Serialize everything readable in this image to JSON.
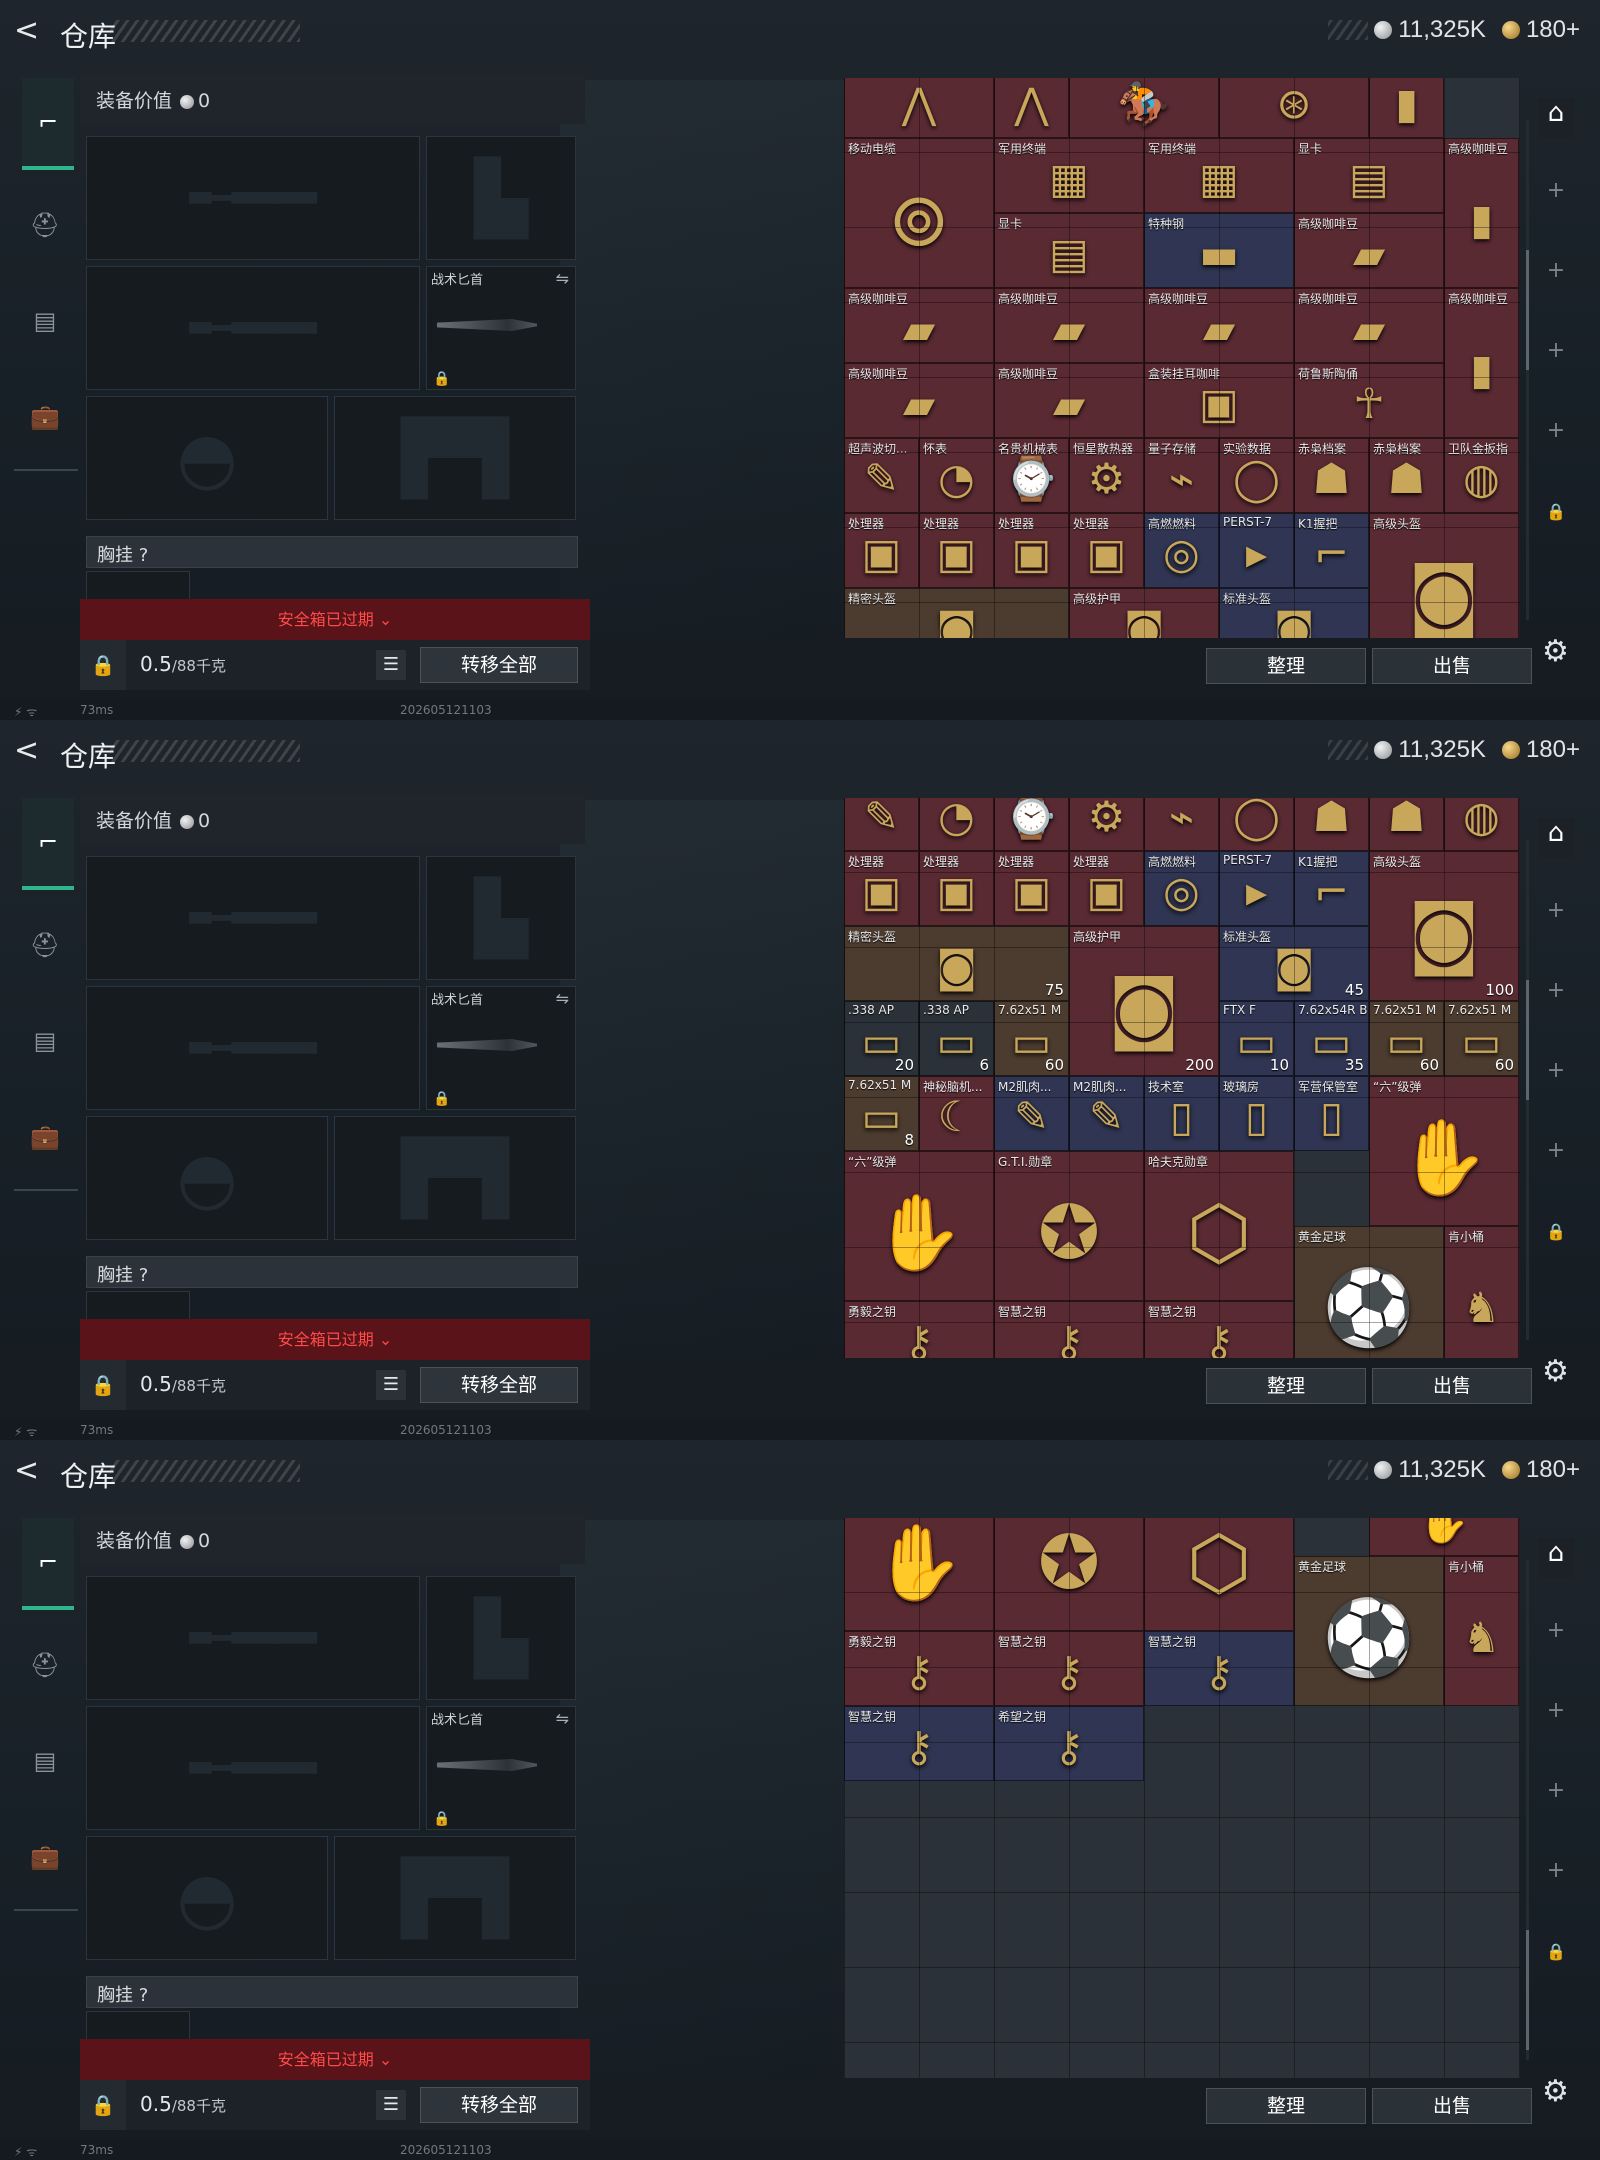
{
  "header": {
    "back_glyph": "<",
    "title": "仓库",
    "coins": "11,325K",
    "tickets": "180+"
  },
  "equip": {
    "value_label": "装备价值",
    "value": "0",
    "knife_label": "战术匕首",
    "chest_label": "胸挂",
    "chest_help": "?",
    "expired": "安全箱已过期",
    "weight": "0.5",
    "weight_unit": "/88千克",
    "transfer_all": "转移全部"
  },
  "actions": {
    "sort": "整理",
    "sell": "出售"
  },
  "status": {
    "ping": "73ms",
    "build": "202605121103"
  },
  "icons": [
    "back-icon",
    "silver-coin-icon",
    "gold-coin-icon",
    "gun-icon",
    "backpack-icon",
    "vest-icon",
    "briefcase-icon",
    "lock-icon",
    "list-icon",
    "gear-icon",
    "safehouse-icon",
    "plus-icon",
    "swap-icon"
  ],
  "screens": [
    {
      "items": [
        {
          "name": "",
          "color": "red",
          "c": 0,
          "r": -0.2,
          "w": 2,
          "h": 1,
          "glyph": "⋀"
        },
        {
          "name": "",
          "color": "red",
          "c": 2,
          "r": -0.2,
          "w": 1,
          "h": 1,
          "glyph": "⋀"
        },
        {
          "name": "",
          "color": "red",
          "c": 3,
          "r": -0.2,
          "w": 2,
          "h": 1,
          "glyph": "🏇"
        },
        {
          "name": "",
          "color": "red",
          "c": 5,
          "r": -0.2,
          "w": 2,
          "h": 1,
          "glyph": "⊛"
        },
        {
          "name": "",
          "color": "red",
          "c": 7,
          "r": -0.2,
          "w": 1,
          "h": 1,
          "glyph": "▮"
        },
        {
          "name": "移动电缆",
          "color": "red",
          "c": 0,
          "r": 0.8,
          "w": 2,
          "h": 2,
          "glyph": "⊚"
        },
        {
          "name": "军用终端",
          "color": "red",
          "c": 2,
          "r": 0.8,
          "w": 2,
          "h": 1,
          "glyph": "▦"
        },
        {
          "name": "军用终端",
          "color": "red",
          "c": 4,
          "r": 0.8,
          "w": 2,
          "h": 1,
          "glyph": "▦"
        },
        {
          "name": "显卡",
          "color": "red",
          "c": 6,
          "r": 0.8,
          "w": 2,
          "h": 1,
          "glyph": "▤"
        },
        {
          "name": "高级咖啡豆",
          "color": "red",
          "c": 8,
          "r": 0.8,
          "w": 1,
          "h": 2,
          "glyph": "▮"
        },
        {
          "name": "显卡",
          "color": "red",
          "c": 2,
          "r": 1.8,
          "w": 2,
          "h": 1,
          "glyph": "▤"
        },
        {
          "name": "特种钢",
          "color": "blue",
          "c": 4,
          "r": 1.8,
          "w": 2,
          "h": 1,
          "glyph": "▬"
        },
        {
          "name": "高级咖啡豆",
          "color": "red",
          "c": 6,
          "r": 1.8,
          "w": 2,
          "h": 1,
          "glyph": "▰"
        },
        {
          "name": "高级咖啡豆",
          "color": "red",
          "c": 0,
          "r": 2.8,
          "w": 2,
          "h": 1,
          "glyph": "▰"
        },
        {
          "name": "高级咖啡豆",
          "color": "red",
          "c": 2,
          "r": 2.8,
          "w": 2,
          "h": 1,
          "glyph": "▰"
        },
        {
          "name": "高级咖啡豆",
          "color": "red",
          "c": 4,
          "r": 2.8,
          "w": 2,
          "h": 1,
          "glyph": "▰"
        },
        {
          "name": "高级咖啡豆",
          "color": "red",
          "c": 6,
          "r": 2.8,
          "w": 2,
          "h": 1,
          "glyph": "▰"
        },
        {
          "name": "高级咖啡豆",
          "color": "red",
          "c": 8,
          "r": 2.8,
          "w": 1,
          "h": 2,
          "glyph": "▮"
        },
        {
          "name": "高级咖啡豆",
          "color": "red",
          "c": 0,
          "r": 3.8,
          "w": 2,
          "h": 1,
          "glyph": "▰"
        },
        {
          "name": "高级咖啡豆",
          "color": "red",
          "c": 2,
          "r": 3.8,
          "w": 2,
          "h": 1,
          "glyph": "▰"
        },
        {
          "name": "盒装挂耳咖啡",
          "color": "red",
          "c": 4,
          "r": 3.8,
          "w": 2,
          "h": 1,
          "glyph": "▣"
        },
        {
          "name": "荷鲁斯陶俑",
          "color": "red",
          "c": 6,
          "r": 3.8,
          "w": 2,
          "h": 1,
          "glyph": "☥"
        },
        {
          "name": "超声波切...",
          "color": "red",
          "c": 0,
          "r": 4.8,
          "w": 1,
          "h": 1,
          "glyph": "✎"
        },
        {
          "name": "怀表",
          "color": "red",
          "c": 1,
          "r": 4.8,
          "w": 1,
          "h": 1,
          "glyph": "◔"
        },
        {
          "name": "名贵机械表",
          "color": "red",
          "c": 2,
          "r": 4.8,
          "w": 1,
          "h": 1,
          "glyph": "⌚"
        },
        {
          "name": "恒星散热器",
          "color": "red",
          "c": 3,
          "r": 4.8,
          "w": 1,
          "h": 1,
          "glyph": "⚙"
        },
        {
          "name": "量子存储",
          "color": "red",
          "c": 4,
          "r": 4.8,
          "w": 1,
          "h": 1,
          "glyph": "⌁"
        },
        {
          "name": "实验数据",
          "color": "red",
          "c": 5,
          "r": 4.8,
          "w": 1,
          "h": 1,
          "glyph": "◯"
        },
        {
          "name": "赤枭档案",
          "color": "red",
          "c": 6,
          "r": 4.8,
          "w": 1,
          "h": 1,
          "glyph": "☗"
        },
        {
          "name": "赤枭档案",
          "color": "red",
          "c": 7,
          "r": 4.8,
          "w": 1,
          "h": 1,
          "glyph": "☗"
        },
        {
          "name": "卫队金扳指",
          "color": "red",
          "c": 8,
          "r": 4.8,
          "w": 1,
          "h": 1,
          "glyph": "◍"
        },
        {
          "name": "处理器",
          "color": "red",
          "c": 0,
          "r": 5.8,
          "w": 1,
          "h": 1,
          "glyph": "▣"
        },
        {
          "name": "处理器",
          "color": "red",
          "c": 1,
          "r": 5.8,
          "w": 1,
          "h": 1,
          "glyph": "▣"
        },
        {
          "name": "处理器",
          "color": "red",
          "c": 2,
          "r": 5.8,
          "w": 1,
          "h": 1,
          "glyph": "▣"
        },
        {
          "name": "处理器",
          "color": "red",
          "c": 3,
          "r": 5.8,
          "w": 1,
          "h": 1,
          "glyph": "▣"
        },
        {
          "name": "高燃燃料",
          "color": "blue",
          "c": 4,
          "r": 5.8,
          "w": 1,
          "h": 1,
          "glyph": "◎"
        },
        {
          "name": "PERST-7",
          "color": "blue",
          "c": 5,
          "r": 5.8,
          "w": 1,
          "h": 1,
          "glyph": "▸"
        },
        {
          "name": "K1握把",
          "color": "blue",
          "c": 6,
          "r": 5.8,
          "w": 1,
          "h": 1,
          "glyph": "⌐"
        },
        {
          "name": "高级头盔",
          "color": "red",
          "c": 7,
          "r": 5.8,
          "w": 2,
          "h": 2,
          "glyph": "◙"
        },
        {
          "name": "精密头盔",
          "color": "brown",
          "c": 0,
          "r": 6.8,
          "w": 3,
          "h": 1,
          "glyph": "◙"
        },
        {
          "name": "高级护甲",
          "color": "red",
          "c": 3,
          "r": 6.8,
          "w": 2,
          "h": 1,
          "glyph": "◙"
        },
        {
          "name": "标准头盔",
          "color": "blue",
          "c": 5,
          "r": 6.8,
          "w": 2,
          "h": 1,
          "glyph": "◙"
        }
      ]
    },
    {
      "items": [
        {
          "name": "超声波切...",
          "color": "red",
          "c": 0,
          "r": -0.3,
          "w": 1,
          "h": 1,
          "glyph": "✎"
        },
        {
          "name": "怀表",
          "color": "red",
          "c": 1,
          "r": -0.3,
          "w": 1,
          "h": 1,
          "glyph": "◔"
        },
        {
          "name": "名贵机械表",
          "color": "red",
          "c": 2,
          "r": -0.3,
          "w": 1,
          "h": 1,
          "glyph": "⌚"
        },
        {
          "name": "恒星散热器",
          "color": "red",
          "c": 3,
          "r": -0.3,
          "w": 1,
          "h": 1,
          "glyph": "⚙"
        },
        {
          "name": "量子存储",
          "color": "red",
          "c": 4,
          "r": -0.3,
          "w": 1,
          "h": 1,
          "glyph": "⌁"
        },
        {
          "name": "实验数据",
          "color": "red",
          "c": 5,
          "r": -0.3,
          "w": 1,
          "h": 1,
          "glyph": "◯"
        },
        {
          "name": "赤枭档案",
          "color": "red",
          "c": 6,
          "r": -0.3,
          "w": 1,
          "h": 1,
          "glyph": "☗"
        },
        {
          "name": "赤枭档案",
          "color": "red",
          "c": 7,
          "r": -0.3,
          "w": 1,
          "h": 1,
          "glyph": "☗"
        },
        {
          "name": "卫队金扳指",
          "color": "red",
          "c": 8,
          "r": -0.3,
          "w": 1,
          "h": 1,
          "glyph": "◍"
        },
        {
          "name": "处理器",
          "color": "red",
          "c": 0,
          "r": 0.7,
          "w": 1,
          "h": 1,
          "glyph": "▣"
        },
        {
          "name": "处理器",
          "color": "red",
          "c": 1,
          "r": 0.7,
          "w": 1,
          "h": 1,
          "glyph": "▣"
        },
        {
          "name": "处理器",
          "color": "red",
          "c": 2,
          "r": 0.7,
          "w": 1,
          "h": 1,
          "glyph": "▣"
        },
        {
          "name": "处理器",
          "color": "red",
          "c": 3,
          "r": 0.7,
          "w": 1,
          "h": 1,
          "glyph": "▣"
        },
        {
          "name": "高燃燃料",
          "color": "blue",
          "c": 4,
          "r": 0.7,
          "w": 1,
          "h": 1,
          "glyph": "◎"
        },
        {
          "name": "PERST-7",
          "color": "blue",
          "c": 5,
          "r": 0.7,
          "w": 1,
          "h": 1,
          "glyph": "▸"
        },
        {
          "name": "K1握把",
          "color": "blue",
          "c": 6,
          "r": 0.7,
          "w": 1,
          "h": 1,
          "glyph": "⌐"
        },
        {
          "name": "高级头盔",
          "color": "red",
          "c": 7,
          "r": 0.7,
          "w": 2,
          "h": 2,
          "glyph": "◙",
          "qty": "100"
        },
        {
          "name": "精密头盔",
          "color": "brown",
          "c": 0,
          "r": 1.7,
          "w": 3,
          "h": 1,
          "glyph": "◙",
          "qty": "75"
        },
        {
          "name": "高级护甲",
          "color": "red",
          "c": 3,
          "r": 1.7,
          "w": 2,
          "h": 2,
          "glyph": "◙",
          "qty": "200"
        },
        {
          "name": "标准头盔",
          "color": "blue",
          "c": 5,
          "r": 1.7,
          "w": 2,
          "h": 1,
          "glyph": "◙",
          "qty": "45"
        },
        {
          "name": ".338 AP",
          "color": "dark",
          "c": 0,
          "r": 2.7,
          "w": 1,
          "h": 1,
          "glyph": "▭",
          "qty": "20"
        },
        {
          "name": ".338 AP",
          "color": "dark",
          "c": 1,
          "r": 2.7,
          "w": 1,
          "h": 1,
          "glyph": "▭",
          "qty": "6"
        },
        {
          "name": "7.62x51 M",
          "color": "brown",
          "c": 2,
          "r": 2.7,
          "w": 1,
          "h": 1,
          "glyph": "▭",
          "qty": "60"
        },
        {
          "name": "FTX F",
          "color": "blue",
          "c": 5,
          "r": 2.7,
          "w": 1,
          "h": 1,
          "glyph": "▭",
          "qty": "10"
        },
        {
          "name": "7.62x54R B",
          "color": "blue",
          "c": 6,
          "r": 2.7,
          "w": 1,
          "h": 1,
          "glyph": "▭",
          "qty": "35"
        },
        {
          "name": "7.62x51 M",
          "color": "brown",
          "c": 7,
          "r": 2.7,
          "w": 1,
          "h": 1,
          "glyph": "▭",
          "qty": "60"
        },
        {
          "name": "7.62x51 M",
          "color": "brown",
          "c": 8,
          "r": 2.7,
          "w": 1,
          "h": 1,
          "glyph": "▭",
          "qty": "60"
        },
        {
          "name": "7.62x51 M",
          "color": "brown",
          "c": 0,
          "r": 3.7,
          "w": 1,
          "h": 1,
          "glyph": "▭",
          "qty": "8"
        },
        {
          "name": "神秘脑机...",
          "color": "red",
          "c": 1,
          "r": 3.7,
          "w": 1,
          "h": 1,
          "glyph": "☾"
        },
        {
          "name": "M2肌肉...",
          "color": "blue",
          "c": 2,
          "r": 3.7,
          "w": 1,
          "h": 1,
          "glyph": "✎"
        },
        {
          "name": "M2肌肉...",
          "color": "blue",
          "c": 3,
          "r": 3.7,
          "w": 1,
          "h": 1,
          "glyph": "✎"
        },
        {
          "name": "技术室",
          "color": "blue",
          "c": 4,
          "r": 3.7,
          "w": 1,
          "h": 1,
          "glyph": "▯"
        },
        {
          "name": "玻璃房",
          "color": "blue",
          "c": 5,
          "r": 3.7,
          "w": 1,
          "h": 1,
          "glyph": "▯"
        },
        {
          "name": "军营保管室",
          "color": "blue",
          "c": 6,
          "r": 3.7,
          "w": 1,
          "h": 1,
          "glyph": "▯"
        },
        {
          "name": "“六”级弹",
          "color": "red",
          "c": 7,
          "r": 3.7,
          "w": 2,
          "h": 2,
          "glyph": "✋"
        },
        {
          "name": "“六”级弹",
          "color": "red",
          "c": 0,
          "r": 4.7,
          "w": 2,
          "h": 2,
          "glyph": "✋"
        },
        {
          "name": "G.T.I.勋章",
          "color": "red",
          "c": 2,
          "r": 4.7,
          "w": 2,
          "h": 2,
          "glyph": "✪"
        },
        {
          "name": "哈夫克勋章",
          "color": "red",
          "c": 4,
          "r": 4.7,
          "w": 2,
          "h": 2,
          "glyph": "⬡"
        },
        {
          "name": "黄金足球",
          "color": "brown",
          "c": 6,
          "r": 5.7,
          "w": 2,
          "h": 2,
          "glyph": "⚽"
        },
        {
          "name": "肯小桶",
          "color": "red",
          "c": 8,
          "r": 5.7,
          "w": 1,
          "h": 2,
          "glyph": "♞"
        },
        {
          "name": "勇毅之钥",
          "color": "red",
          "c": 0,
          "r": 6.7,
          "w": 2,
          "h": 1,
          "glyph": "⚷"
        },
        {
          "name": "智慧之钥",
          "color": "red",
          "c": 2,
          "r": 6.7,
          "w": 2,
          "h": 1,
          "glyph": "⚷"
        },
        {
          "name": "智慧之钥",
          "color": "red",
          "c": 4,
          "r": 6.7,
          "w": 2,
          "h": 1,
          "glyph": "⚷"
        }
      ]
    },
    {
      "items": [
        {
          "name": "“六”级弹",
          "color": "red",
          "c": 0,
          "r": -0.5,
          "w": 2,
          "h": 2,
          "glyph": "✋"
        },
        {
          "name": "G.T.I.勋章",
          "color": "red",
          "c": 2,
          "r": -0.5,
          "w": 2,
          "h": 2,
          "glyph": "✪"
        },
        {
          "name": "哈夫克勋章",
          "color": "red",
          "c": 4,
          "r": -0.5,
          "w": 2,
          "h": 2,
          "glyph": "⬡"
        },
        {
          "name": "",
          "color": "red",
          "c": 7,
          "r": -0.5,
          "w": 2,
          "h": 1,
          "glyph": "✋"
        },
        {
          "name": "黄金足球",
          "color": "brown",
          "c": 6,
          "r": 0.5,
          "w": 2,
          "h": 2,
          "glyph": "⚽"
        },
        {
          "name": "肯小桶",
          "color": "red",
          "c": 8,
          "r": 0.5,
          "w": 1,
          "h": 2,
          "glyph": "♞"
        },
        {
          "name": "勇毅之钥",
          "color": "red",
          "c": 0,
          "r": 1.5,
          "w": 2,
          "h": 1,
          "glyph": "⚷"
        },
        {
          "name": "智慧之钥",
          "color": "red",
          "c": 2,
          "r": 1.5,
          "w": 2,
          "h": 1,
          "glyph": "⚷"
        },
        {
          "name": "智慧之钥",
          "color": "blue",
          "c": 4,
          "r": 1.5,
          "w": 2,
          "h": 1,
          "glyph": "⚷"
        },
        {
          "name": "智慧之钥",
          "color": "blue",
          "c": 0,
          "r": 2.5,
          "w": 2,
          "h": 1,
          "glyph": "⚷"
        },
        {
          "name": "希望之钥",
          "color": "blue",
          "c": 2,
          "r": 2.5,
          "w": 2,
          "h": 1,
          "glyph": "⚷"
        }
      ]
    }
  ]
}
